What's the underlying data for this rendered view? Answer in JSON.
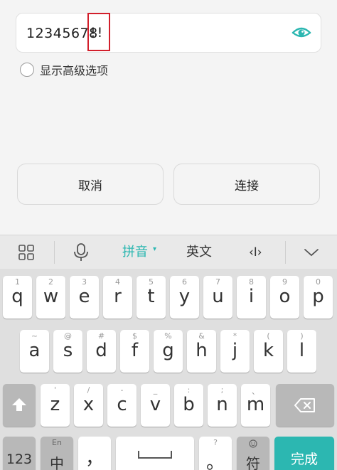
{
  "form": {
    "password_value": "12345678",
    "password_highlight": "!!",
    "show_advanced_label": "显示高级选项",
    "cancel_label": "取消",
    "connect_label": "连接"
  },
  "keyboard_bar": {
    "pinyin_label": "拼音",
    "english_label": "英文",
    "cursor_label": "‹I›"
  },
  "keyboard": {
    "row1": [
      {
        "hint": "1",
        "key": "q"
      },
      {
        "hint": "2",
        "key": "w"
      },
      {
        "hint": "3",
        "key": "e"
      },
      {
        "hint": "4",
        "key": "r"
      },
      {
        "hint": "5",
        "key": "t"
      },
      {
        "hint": "6",
        "key": "y"
      },
      {
        "hint": "7",
        "key": "u"
      },
      {
        "hint": "8",
        "key": "i"
      },
      {
        "hint": "9",
        "key": "o"
      },
      {
        "hint": "0",
        "key": "p"
      }
    ],
    "row2": [
      {
        "hint": "~",
        "key": "a"
      },
      {
        "hint": "@",
        "key": "s"
      },
      {
        "hint": "#",
        "key": "d"
      },
      {
        "hint": "$",
        "key": "f"
      },
      {
        "hint": "%",
        "key": "g"
      },
      {
        "hint": "&",
        "key": "h"
      },
      {
        "hint": "*",
        "key": "j"
      },
      {
        "hint": "(",
        "key": "k"
      },
      {
        "hint": ")",
        "key": "l"
      }
    ],
    "row3": [
      {
        "hint": "'",
        "key": "z"
      },
      {
        "hint": "/",
        "key": "x"
      },
      {
        "hint": "-",
        "key": "c"
      },
      {
        "hint": "_",
        "key": "v"
      },
      {
        "hint": ":",
        "key": "b"
      },
      {
        "hint": ";",
        "key": "n"
      },
      {
        "hint": "、",
        "key": "m"
      }
    ],
    "num_label": "123",
    "lang_hint": "En",
    "lang_label": "中",
    "comma_label": "，",
    "period_hint": "?",
    "period_label": "。",
    "symbol_label": "符",
    "done_label": "完成"
  }
}
